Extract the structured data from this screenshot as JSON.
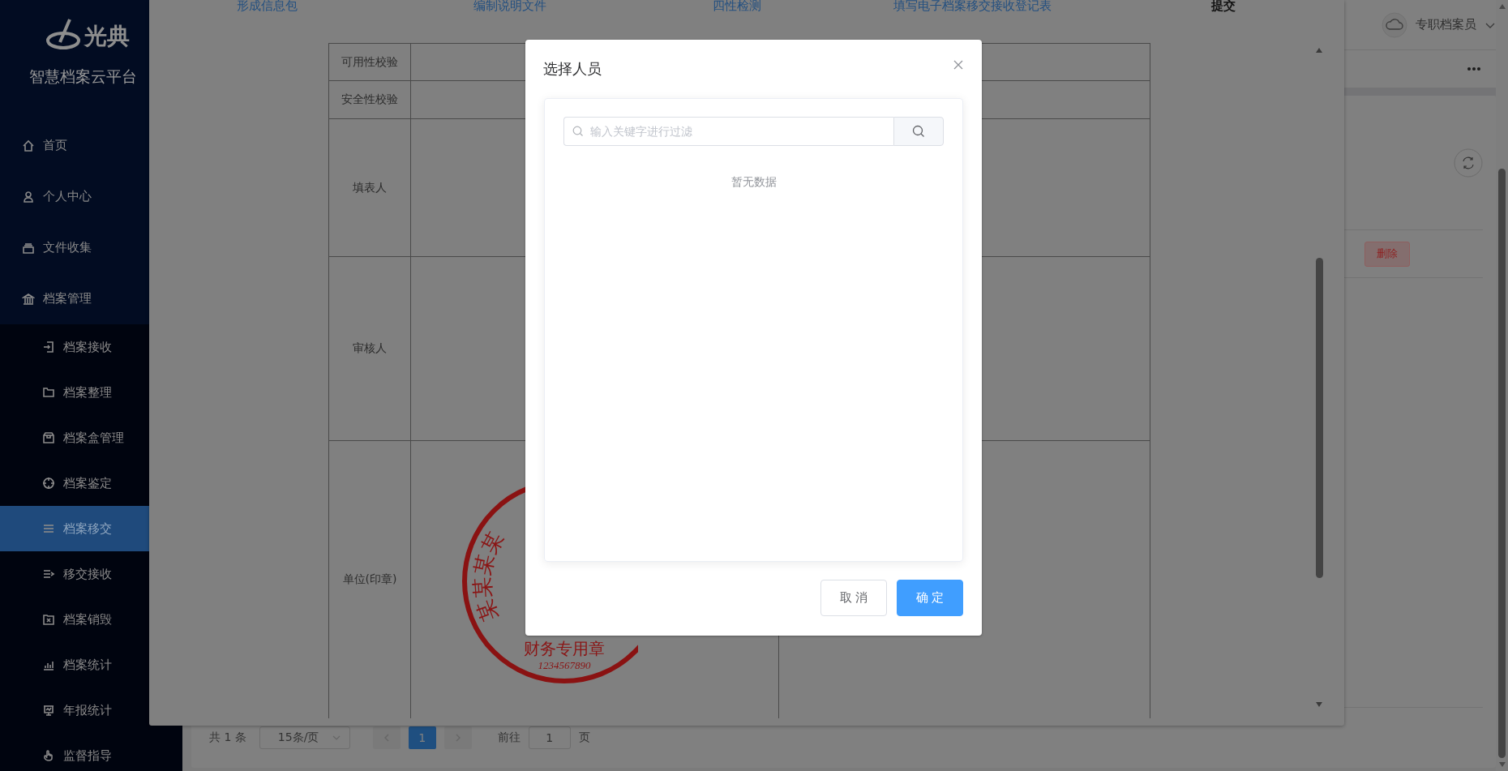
{
  "sidebar": {
    "logo_text": "光典",
    "title": "智慧档案云平台",
    "items": [
      {
        "label": "首页",
        "selected": false
      },
      {
        "label": "个人中心",
        "selected": false
      },
      {
        "label": "文件收集",
        "selected": false
      },
      {
        "label": "档案管理",
        "selected": false,
        "expanded": true,
        "children": [
          {
            "label": "档案接收",
            "selected": false
          },
          {
            "label": "档案整理",
            "selected": false
          },
          {
            "label": "档案盒管理",
            "selected": false
          },
          {
            "label": "档案鉴定",
            "selected": false
          },
          {
            "label": "档案移交",
            "selected": true
          },
          {
            "label": "移交接收",
            "selected": false
          },
          {
            "label": "档案销毁",
            "selected": false
          },
          {
            "label": "档案统计",
            "selected": false
          },
          {
            "label": "年报统计",
            "selected": false
          },
          {
            "label": "监督指导",
            "selected": false
          }
        ]
      }
    ]
  },
  "header": {
    "user_name": "专职档案员"
  },
  "toolbar": {
    "delete_button": "删除"
  },
  "pagination": {
    "total": "共 1 条",
    "page_size": "15条/页",
    "pages": [
      {
        "label": "1",
        "selected": true
      }
    ],
    "goto_label": "前往",
    "goto_value": "1",
    "goto_unit": "页"
  },
  "transfer_dialog": {
    "steps": [
      {
        "label": "形成信息包",
        "selected": false
      },
      {
        "label": "编制说明文件",
        "selected": false
      },
      {
        "label": "四性检测",
        "selected": false
      },
      {
        "label": "填写电子档案移交接收登记表",
        "selected": false
      },
      {
        "label": "提交",
        "selected": true
      }
    ],
    "form_rows": [
      {
        "label": "可用性校验"
      },
      {
        "label": "安全性校验"
      },
      {
        "label": "填表人"
      },
      {
        "label": "审核人"
      },
      {
        "label": "单位(印章)"
      }
    ],
    "seal": {
      "arc_text": "某某某某",
      "name": "财务专用章",
      "number": "1234567890"
    }
  },
  "select_dialog": {
    "title": "选择人员",
    "search": {
      "placeholder": "输入关键字进行过滤"
    },
    "empty_text": "暂无数据",
    "cancel_button": "取消",
    "confirm_button": "确定"
  }
}
